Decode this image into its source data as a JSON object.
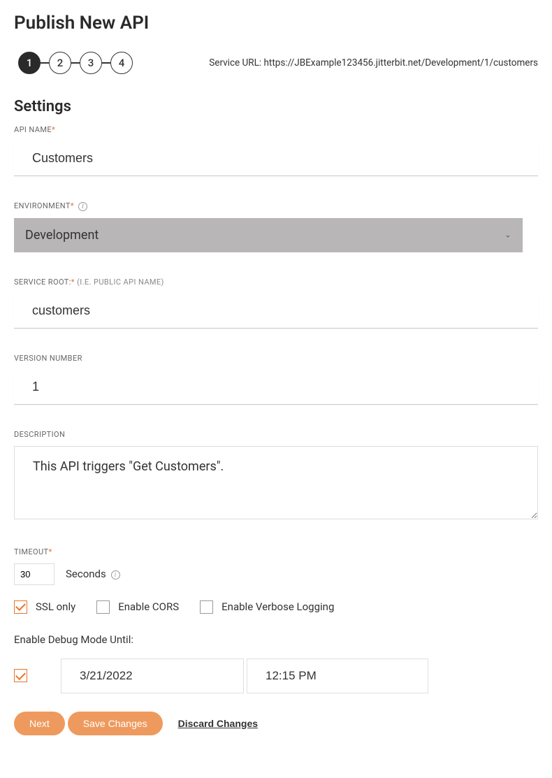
{
  "page_title": "Publish New API",
  "stepper": {
    "steps": [
      "1",
      "2",
      "3",
      "4"
    ],
    "active_index": 0
  },
  "service_url": {
    "label": "Service URL: ",
    "value": "https://JBExample123456.jitterbit.net/Development/1/customers"
  },
  "section_title": "Settings",
  "fields": {
    "api_name": {
      "label": "API NAME",
      "value": "Customers"
    },
    "environment": {
      "label": "ENVIRONMENT",
      "value": "Development"
    },
    "service_root": {
      "label": "SERVICE ROOT:",
      "hint": " (I.E. PUBLIC API NAME)",
      "value": "customers"
    },
    "version_number": {
      "label": "VERSION NUMBER",
      "value": "1"
    },
    "description": {
      "label": "DESCRIPTION",
      "value": "This API triggers \"Get Customers\"."
    },
    "timeout": {
      "label": "TIMEOUT",
      "value": "30",
      "unit": "Seconds"
    }
  },
  "checkboxes": {
    "ssl_only": {
      "label": "SSL only",
      "checked": true
    },
    "enable_cors": {
      "label": "Enable CORS",
      "checked": false
    },
    "enable_verbose": {
      "label": "Enable Verbose Logging",
      "checked": false
    }
  },
  "debug": {
    "label": "Enable Debug Mode Until:",
    "checked": true,
    "date": "3/21/2022",
    "time": "12:15 PM"
  },
  "buttons": {
    "next": "Next",
    "save": "Save Changes",
    "discard": "Discard Changes"
  }
}
